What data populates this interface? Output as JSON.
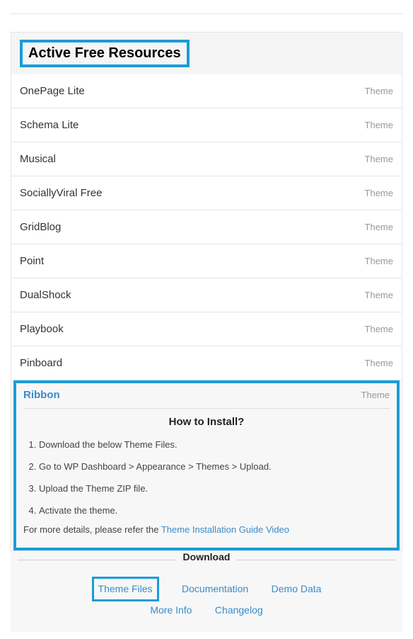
{
  "header": {
    "title": "Active Free Resources"
  },
  "items": [
    {
      "name": "OnePage Lite",
      "type": "Theme"
    },
    {
      "name": "Schema Lite",
      "type": "Theme"
    },
    {
      "name": "Musical",
      "type": "Theme"
    },
    {
      "name": "SociallyViral Free",
      "type": "Theme"
    },
    {
      "name": "GridBlog",
      "type": "Theme"
    },
    {
      "name": "Point",
      "type": "Theme"
    },
    {
      "name": "DualShock",
      "type": "Theme"
    },
    {
      "name": "Playbook",
      "type": "Theme"
    },
    {
      "name": "Pinboard",
      "type": "Theme"
    }
  ],
  "expanded": {
    "name": "Ribbon",
    "type": "Theme",
    "howto_title": "How to Install?",
    "steps": [
      "Download the below Theme Files.",
      "Go to WP Dashboard > Appearance > Themes > Upload.",
      "Upload the Theme ZIP file.",
      "Activate the theme."
    ],
    "more_text": "For more details, please refer the ",
    "more_link": "Theme Installation Guide Video"
  },
  "download": {
    "title": "Download",
    "links": {
      "theme_files": "Theme Files",
      "documentation": "Documentation",
      "demo_data": "Demo Data",
      "more_info": "More Info",
      "changelog": "Changelog"
    }
  }
}
